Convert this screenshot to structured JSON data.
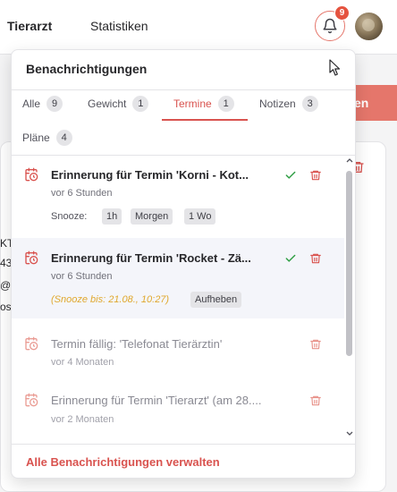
{
  "topnav": {
    "items": [
      "Tierarzt",
      "Statistiken"
    ],
    "notification_badge": "9"
  },
  "background": {
    "button_label_fragment": "en",
    "left_fragments": [
      "KT",
      "43",
      "@",
      "os"
    ]
  },
  "notifications_panel": {
    "title": "Benachrichtigungen",
    "tabs": [
      {
        "label": "Alle",
        "count": "9",
        "active": false
      },
      {
        "label": "Gewicht",
        "count": "1",
        "active": false
      },
      {
        "label": "Termine",
        "count": "1",
        "active": true
      },
      {
        "label": "Notizen",
        "count": "3",
        "active": false
      },
      {
        "label": "Pläne",
        "count": "4",
        "active": false
      }
    ],
    "items": [
      {
        "title": "Erinnerung für Termin 'Korni - Kot...",
        "time": "vor 6 Stunden",
        "snooze_label": "Snooze:",
        "snooze_options": [
          "1h",
          "Morgen",
          "1 Wo"
        ],
        "read": false
      },
      {
        "title": "Erinnerung für Termin 'Rocket - Zä...",
        "time": "vor 6 Stunden",
        "snoozed_until": "(Snooze bis: 21.08., 10:27)",
        "unsnooze_label": "Aufheben",
        "read": false
      },
      {
        "title": "Termin fällig: 'Telefonat Tierärztin'",
        "time": "vor 4 Monaten",
        "read": true
      },
      {
        "title": "Erinnerung für Termin 'Tierarzt' (am 28....",
        "time": "vor 2 Monaten",
        "read": true
      }
    ],
    "footer_link": "Alle Benachrichtigungen verwalten"
  },
  "colors": {
    "accent": "#d9534f",
    "badge": "#e5533f",
    "snooze_text": "#e0a82e",
    "check": "#2f9e44"
  },
  "icons": [
    "bell-icon",
    "calendar-clock-icon",
    "check-icon",
    "trash-icon",
    "cursor-icon",
    "chevron-up-icon",
    "chevron-down-icon"
  ]
}
